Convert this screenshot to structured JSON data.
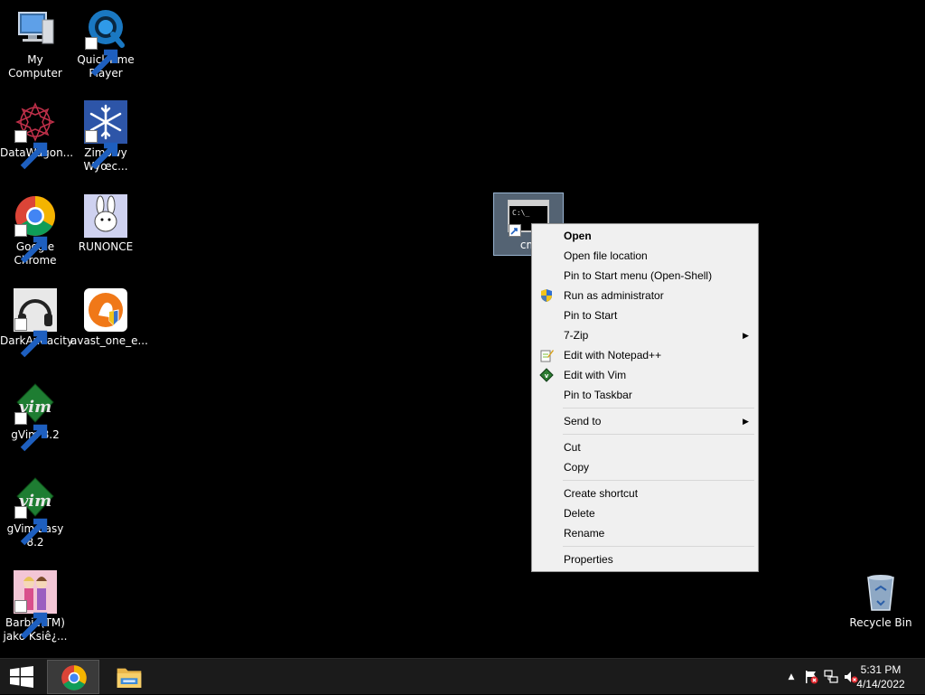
{
  "desktop": {
    "icons": [
      {
        "label": "My Computer",
        "icon": "computer-icon"
      },
      {
        "label": "QuickTime\nPlayer",
        "icon": "quicktime-icon"
      },
      {
        "label": "DataWagon...",
        "icon": "datawagon-icon"
      },
      {
        "label": "Zimowy\nWyœc...",
        "icon": "snowflake-icon"
      },
      {
        "label": "Google\nChrome",
        "icon": "chrome-icon"
      },
      {
        "label": "RUNONCE",
        "icon": "bunny-icon"
      },
      {
        "label": "DarkAudacity",
        "icon": "headphones-icon"
      },
      {
        "label": "avast_one_e...",
        "icon": "avast-icon"
      },
      {
        "label": "gVim 8.2",
        "icon": "vim-icon"
      },
      {
        "label": "gVim Easy 8.2",
        "icon": "vim-icon"
      },
      {
        "label": "Barbie(TM)\njako Ksiê¿...",
        "icon": "barbie-icon"
      },
      {
        "label": "Recycle Bin",
        "icon": "recycle-bin-icon"
      }
    ],
    "selected_icon": {
      "label": "cm",
      "icon": "cmd-icon",
      "icon_text": "C:\\_"
    }
  },
  "context_menu": {
    "items": [
      {
        "label": "Open"
      },
      {
        "label": "Open file location"
      },
      {
        "label": "Pin to Start menu (Open-Shell)"
      },
      {
        "label": "Run as administrator",
        "icon": "uac-shield-icon"
      },
      {
        "label": "Pin to Start"
      },
      {
        "label": "7-Zip",
        "submenu": "▶"
      },
      {
        "label": "Edit with Notepad++",
        "icon": "notepadpp-icon"
      },
      {
        "label": "Edit with Vim",
        "icon": "vim-small-icon"
      },
      {
        "label": "Pin to Taskbar"
      },
      {
        "label": "Send to",
        "submenu": "▶"
      },
      {
        "label": "Cut"
      },
      {
        "label": "Copy"
      },
      {
        "label": "Create shortcut"
      },
      {
        "label": "Delete"
      },
      {
        "label": "Rename"
      },
      {
        "label": "Properties"
      }
    ]
  },
  "taskbar": {
    "apps": [
      {
        "name": "Google Chrome",
        "icon": "chrome-icon",
        "active": true
      },
      {
        "name": "File Explorer",
        "icon": "folder-icon",
        "active": false
      }
    ],
    "tray": {
      "overflow": "▲",
      "icons": [
        "action-center-flag-icon",
        "network-icon",
        "volume-muted-icon"
      ]
    },
    "clock": {
      "time": "5:31 PM",
      "date": "4/14/2022"
    }
  },
  "colors": {
    "desktop_bg": "#000000",
    "taskbar_bg": "#1b1b1b",
    "menu_bg": "#f0f0f0",
    "selection": "#99b4d1"
  }
}
